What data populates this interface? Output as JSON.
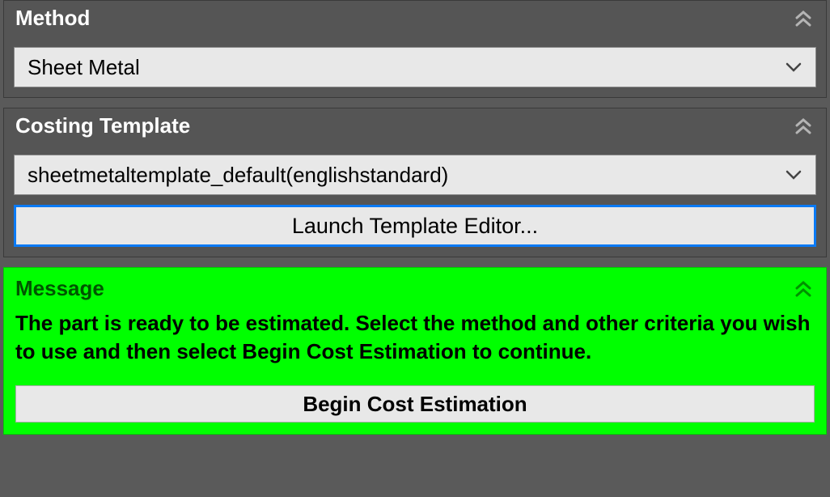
{
  "method": {
    "header": "Method",
    "selected": "Sheet Metal"
  },
  "costing_template": {
    "header": "Costing Template",
    "selected": "sheetmetaltemplate_default(englishstandard)",
    "editor_button": "Launch Template Editor..."
  },
  "message": {
    "header": "Message",
    "body": "The part is ready to be estimated. Select the method and other criteria you wish to use and then select Begin Cost Estimation to continue.",
    "begin_button": "Begin Cost Estimation"
  }
}
